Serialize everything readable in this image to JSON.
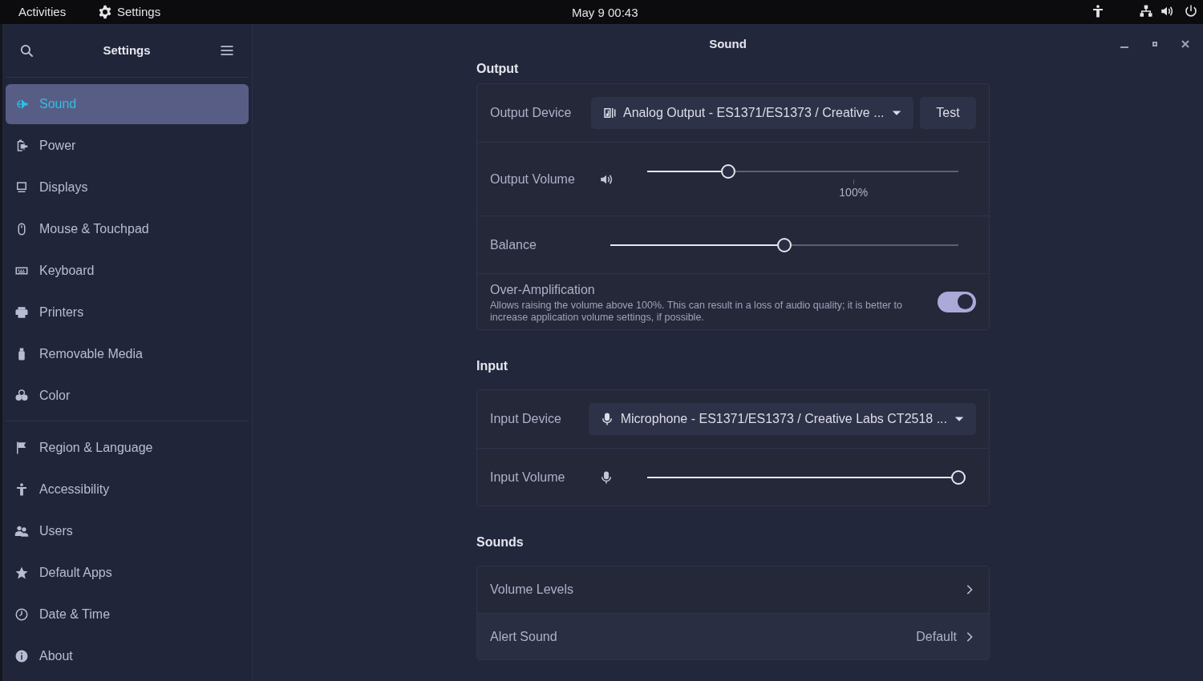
{
  "top_bar": {
    "activities": "Activities",
    "app_menu": "Settings",
    "clock": "May 9  00:43"
  },
  "sidebar": {
    "title": "Settings",
    "groups": [
      [
        {
          "label": "Sound",
          "selected": true
        },
        {
          "label": "Power",
          "selected": false
        },
        {
          "label": "Displays",
          "selected": false
        },
        {
          "label": "Mouse & Touchpad",
          "selected": false
        },
        {
          "label": "Keyboard",
          "selected": false
        },
        {
          "label": "Printers",
          "selected": false
        },
        {
          "label": "Removable Media",
          "selected": false
        },
        {
          "label": "Color",
          "selected": false
        }
      ],
      [
        {
          "label": "Region & Language",
          "selected": false
        },
        {
          "label": "Accessibility",
          "selected": false
        },
        {
          "label": "Users",
          "selected": false
        },
        {
          "label": "Default Apps",
          "selected": false
        },
        {
          "label": "Date & Time",
          "selected": false
        },
        {
          "label": "About",
          "selected": false
        }
      ]
    ]
  },
  "window": {
    "title": "Sound"
  },
  "sections": [
    {
      "title": "Output",
      "rows": [
        {
          "kind": "device",
          "label": "Output Device",
          "value": "Analog Output - ES1371/ES1373 / Creative ...",
          "button": "Test"
        },
        {
          "kind": "volume",
          "label": "Output Volume",
          "level": 0.26,
          "mark": "100%"
        },
        {
          "kind": "balance",
          "label": "Balance",
          "level": 0.5
        },
        {
          "kind": "switch",
          "label": "Over-Amplification",
          "description": "Allows raising the volume above 100%. This can result in a loss of audio quality; it is better to increase application volume settings, if possible.",
          "on": true
        }
      ]
    },
    {
      "title": "Input",
      "rows": [
        {
          "kind": "device",
          "label": "Input Device",
          "value": "Microphone - ES1371/ES1373 / Creative Labs CT2518 ..."
        },
        {
          "kind": "volume",
          "label": "Input Volume",
          "level": 1.0
        }
      ]
    },
    {
      "title": "Sounds",
      "rows": [
        {
          "kind": "link",
          "label": "Volume Levels"
        },
        {
          "kind": "link",
          "label": "Alert Sound",
          "value": "Default"
        }
      ]
    }
  ]
}
